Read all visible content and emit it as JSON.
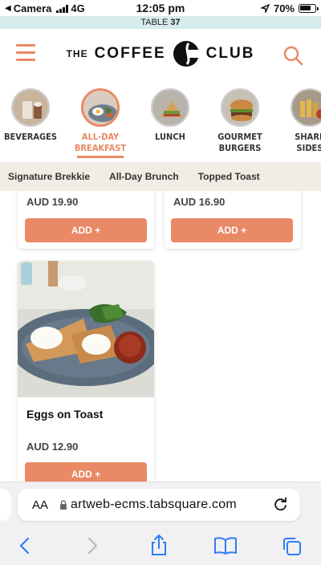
{
  "status_bar": {
    "back_app": "Camera",
    "network": "4G",
    "time": "12:05 pm",
    "battery": "70%"
  },
  "table_bar": {
    "prefix": "TABLE",
    "number": "37"
  },
  "header": {
    "logo_the": "THE",
    "logo_coffee": "COFFEE",
    "logo_club": "CLUB"
  },
  "categories": [
    {
      "line1": "BEVERAGES",
      "line2": "",
      "active": false
    },
    {
      "line1": "ALL-DAY",
      "line2": "BREAKFAST",
      "active": true
    },
    {
      "line1": "LUNCH",
      "line2": "",
      "active": false
    },
    {
      "line1": "GOURMET",
      "line2": "BURGERS",
      "active": false
    },
    {
      "line1": "SHARE",
      "line2": "SIDES",
      "active": false
    }
  ],
  "subtabs": [
    "Signature Brekkie",
    "All-Day Brunch",
    "Topped Toast"
  ],
  "items": [
    {
      "name": "",
      "price": "AUD 19.90",
      "button": "ADD +"
    },
    {
      "name": "",
      "price": "AUD 16.90",
      "button": "ADD +"
    },
    {
      "name": "Eggs on Toast",
      "price": "AUD 12.90",
      "button": "ADD +"
    }
  ],
  "safari": {
    "text_size": "AA",
    "url": "artweb-ecms.tabsquare.com"
  },
  "colors": {
    "accent": "#e98966",
    "table_bar_bg": "#d6ecec",
    "subtab_bg": "#f1ece4"
  }
}
